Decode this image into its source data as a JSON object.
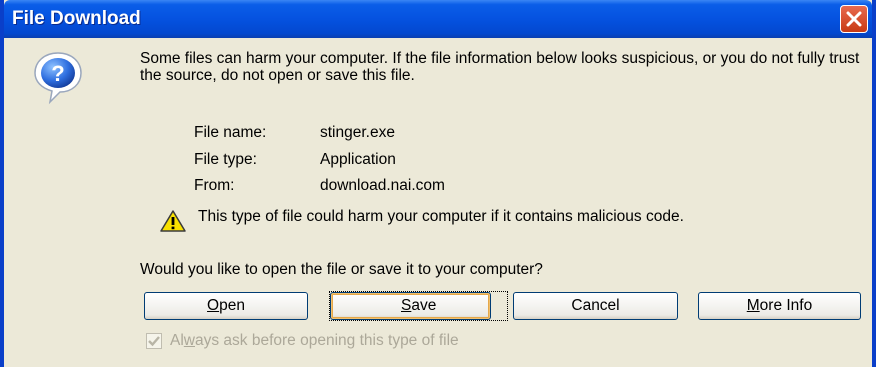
{
  "dialog": {
    "title": "File Download",
    "intro": "Some files can harm your computer. If the file information below looks suspicious, or you do not fully trust the source, do not open or save this file.",
    "file_info": {
      "name_label": "File name:",
      "name_value": "stinger.exe",
      "type_label": "File type:",
      "type_value": "Application",
      "from_label": "From:",
      "from_value": "download.nai.com"
    },
    "warning": "This type of file could harm your computer if it contains malicious code.",
    "question": "Would you like to open the file or save it to your computer?",
    "buttons": {
      "open": {
        "accel": "O",
        "rest": "pen"
      },
      "save": {
        "accel": "S",
        "rest": "ave"
      },
      "cancel": "Cancel",
      "more_info": {
        "accel": "M",
        "rest": "ore Info"
      }
    },
    "checkbox": {
      "pre": "Al",
      "accel": "w",
      "post": "ays ask before opening this type of file",
      "checked": true,
      "enabled": false
    },
    "icons": {
      "question": "question-icon",
      "warning": "warning-icon",
      "close": "close-icon"
    },
    "colors": {
      "titlebar": "#0552e0",
      "close_button": "#d6512e",
      "dialog_background": "#ece9d8",
      "disabled_text": "#aca899"
    }
  }
}
